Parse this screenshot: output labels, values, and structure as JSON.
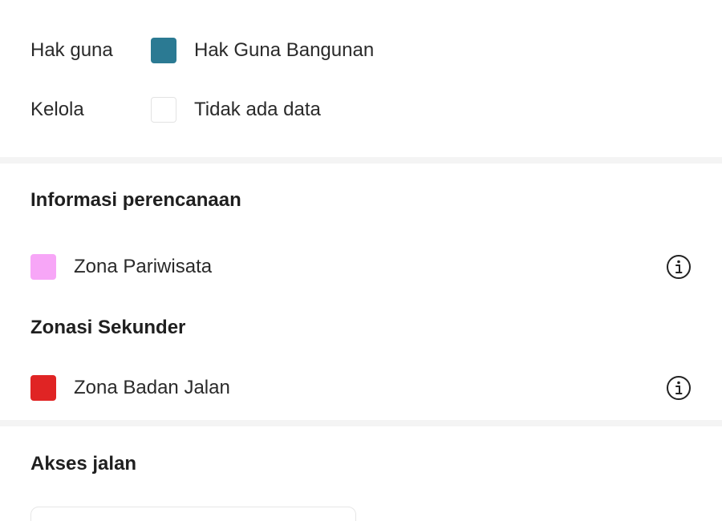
{
  "ownership": {
    "rows": [
      {
        "label": "Hak guna",
        "value": "Hak Guna Bangunan",
        "swatch_color": "#2b7a93"
      },
      {
        "label": "Kelola",
        "value": "Tidak ada data",
        "swatch_color": "#ffffff"
      }
    ]
  },
  "planning": {
    "title": "Informasi perencanaan",
    "primary_zone": {
      "label": "Zona Pariwisata",
      "color": "#f7a6f7",
      "icon": "info-icon"
    },
    "secondary_title": "Zonasi Sekunder",
    "secondary_zone": {
      "label": "Zona Badan Jalan",
      "color": "#e02424",
      "icon": "info-icon"
    }
  },
  "road_access": {
    "title": "Akses jalan"
  },
  "colors": {
    "divider": "#f4f4f4",
    "text": "#1f1f1f"
  }
}
